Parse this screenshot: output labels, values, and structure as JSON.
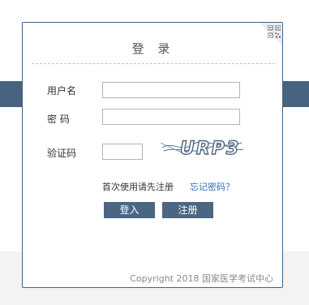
{
  "login": {
    "title": "登 录",
    "username_label": "用户名",
    "password_label": "密 码",
    "captcha_label": "验证码",
    "captcha_image_text": "URP3",
    "first_use_text": "首次使用请先注册",
    "forgot_link": "忘记密码？",
    "login_button": "登入",
    "register_button": "注册",
    "copyright": "Copyright 2018 国家医学考试中心"
  },
  "colors": {
    "band": "#46637f",
    "button": "#4a6682",
    "link": "#2f6fb5"
  },
  "icons": [
    "qr-code-icon"
  ]
}
